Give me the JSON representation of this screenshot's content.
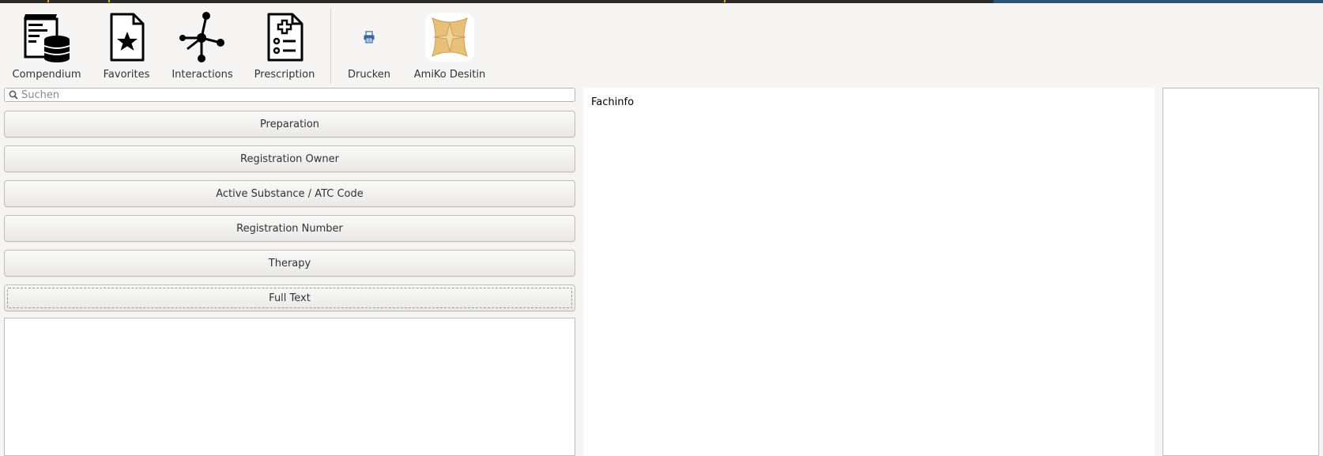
{
  "toolbar": {
    "items": [
      {
        "label": "Compendium",
        "icon": "compendium-icon"
      },
      {
        "label": "Favorites",
        "icon": "favorites-icon"
      },
      {
        "label": "Interactions",
        "icon": "interactions-icon"
      },
      {
        "label": "Prescription",
        "icon": "prescription-icon"
      },
      {
        "label": "Drucken",
        "icon": "print-icon"
      },
      {
        "label": "AmiKo Desitin",
        "icon": "amiko-logo-icon"
      }
    ]
  },
  "search": {
    "placeholder": "Suchen",
    "value": "",
    "icon": "search-icon"
  },
  "search_buttons": [
    {
      "label": "Preparation"
    },
    {
      "label": "Registration Owner"
    },
    {
      "label": "Active Substance / ATC Code"
    },
    {
      "label": "Registration Number"
    },
    {
      "label": "Therapy"
    },
    {
      "label": "Full Text",
      "focused": true
    }
  ],
  "content": {
    "title": "Fachinfo"
  },
  "colors": {
    "window_bg": "#f6f5f4",
    "topbar": "#2b2b2b",
    "topbar_accent": "#2a5378",
    "amiko_logo": "#e8c07a"
  }
}
